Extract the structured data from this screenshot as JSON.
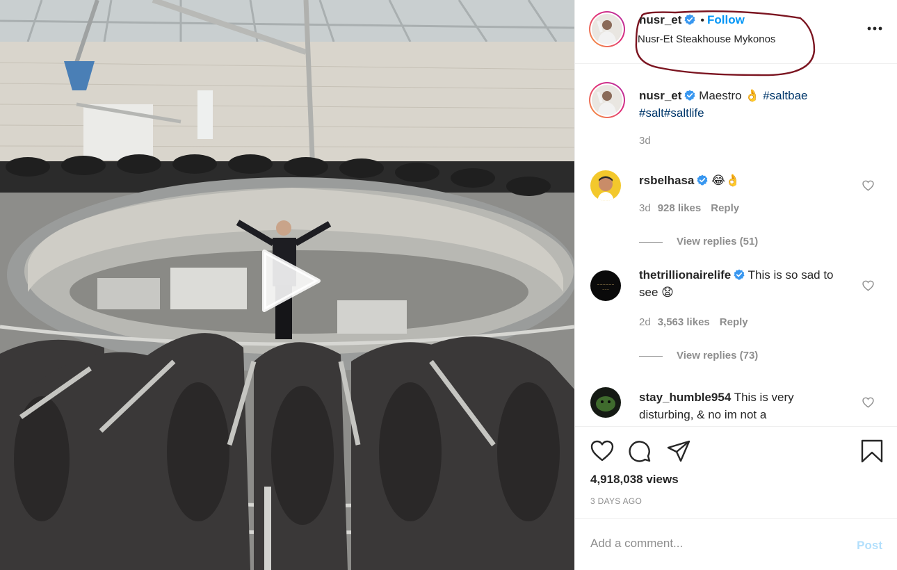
{
  "post": {
    "username": "nusr_et",
    "follow_label": "Follow",
    "separator": "•",
    "location": "Nusr-Et Steakhouse Mykonos"
  },
  "caption": {
    "username": "nusr_et",
    "text_plain": "Maestro 👌",
    "hashtags": [
      "#saltbae",
      "#salt",
      "#saltlife"
    ],
    "age": "3d"
  },
  "comments": [
    {
      "username": "rsbelhasa",
      "text": "😂👌",
      "age": "3d",
      "likes": "928 likes",
      "reply": "Reply",
      "view_replies": "View replies (51)"
    },
    {
      "username": "thetrillionairelife",
      "text": "This is so sad to see 😧",
      "age": "2d",
      "likes": "3,563 likes",
      "reply": "Reply",
      "view_replies": "View replies (73)"
    },
    {
      "username": "stay_humble954",
      "text": "This is very disturbing, & no im not a"
    }
  ],
  "stats": {
    "views": "4,918,038 views",
    "time_ago": "3 DAYS AGO"
  },
  "add_comment": {
    "placeholder": "Add a comment...",
    "post_label": "Post"
  },
  "colors": {
    "accent": "#0095f6",
    "verified": "#3897f0",
    "annotation": "#7b1420",
    "post_disabled": "#b2dffc"
  },
  "icons": [
    "verified-badge-icon",
    "more-options-icon",
    "like-heart-icon",
    "comment-icon",
    "share-icon",
    "save-bookmark-icon",
    "play-icon"
  ]
}
